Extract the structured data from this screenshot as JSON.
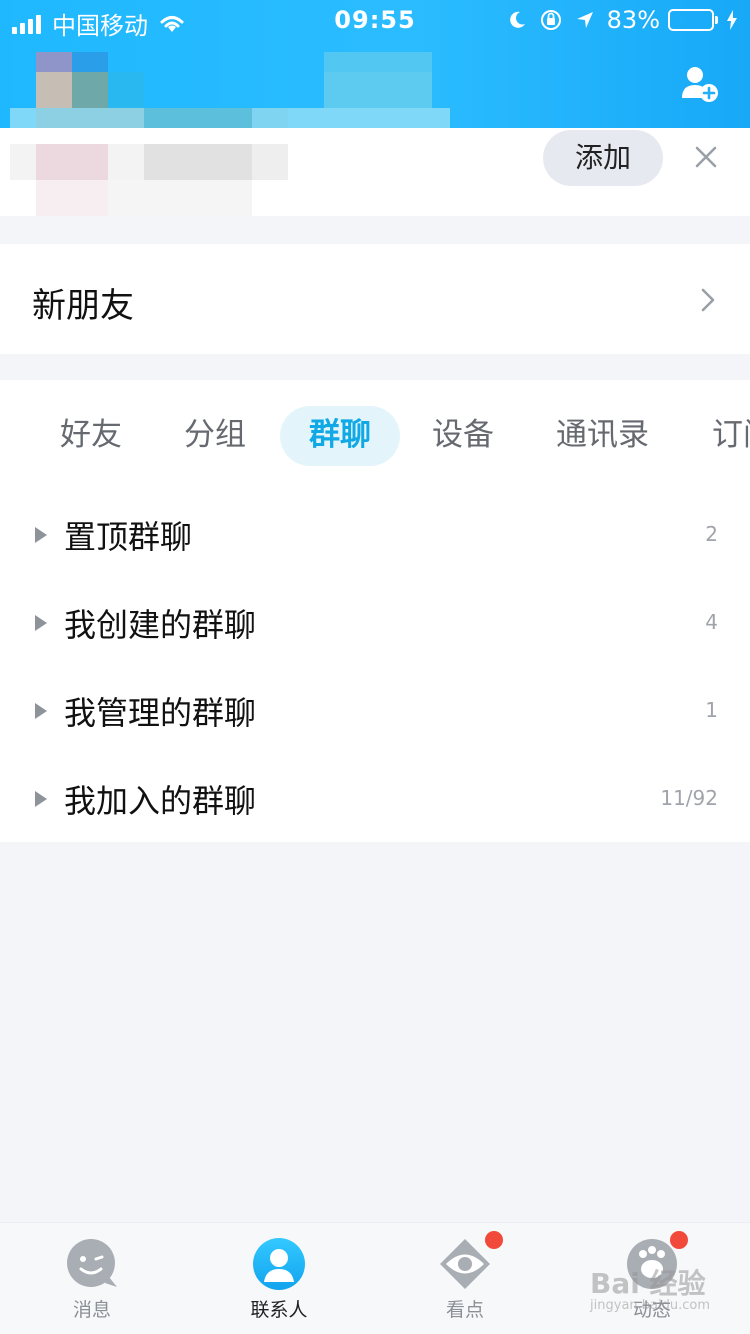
{
  "status_bar": {
    "carrier": "中国移动",
    "time": "09:55",
    "battery_percent": "83%",
    "battery_level": 0.83,
    "icons": [
      "signal-icon",
      "wifi-icon",
      "moon-icon",
      "rotation-lock-icon",
      "location-icon",
      "battery-icon",
      "charging-icon"
    ]
  },
  "header": {
    "add_contact_icon": "add-contact-icon",
    "gradient_colors": [
      "#1fb8ff",
      "#17a9f7"
    ]
  },
  "profile": {
    "add_label": "添加",
    "close_icon": "close-icon"
  },
  "new_friends": {
    "label": "新朋友"
  },
  "tabs": [
    {
      "label": "好友",
      "active": false
    },
    {
      "label": "分组",
      "active": false
    },
    {
      "label": "群聊",
      "active": true
    },
    {
      "label": "设备",
      "active": false
    },
    {
      "label": "通讯录",
      "active": false
    },
    {
      "label": "订阅号",
      "active": false
    }
  ],
  "groups": [
    {
      "name": "置顶群聊",
      "count": "2"
    },
    {
      "name": "我创建的群聊",
      "count": "4"
    },
    {
      "name": "我管理的群聊",
      "count": "1"
    },
    {
      "name": "我加入的群聊",
      "count": "11/92"
    }
  ],
  "tab_bar": {
    "items": [
      {
        "label": "消息",
        "icon": "message-icon",
        "badge": false
      },
      {
        "label": "联系人",
        "icon": "contacts-icon",
        "badge": false,
        "active": true
      },
      {
        "label": "看点",
        "icon": "eye-icon",
        "badge": true
      },
      {
        "label": "动态",
        "icon": "paw-icon",
        "badge": true
      }
    ]
  },
  "watermark": {
    "text": "Bai 经验",
    "sub": "jingyan.baidu.com"
  },
  "colors": {
    "accent": "#10a9e6",
    "active_tab_bg": "#e3f5fb",
    "badge_red": "#f24a3a"
  }
}
